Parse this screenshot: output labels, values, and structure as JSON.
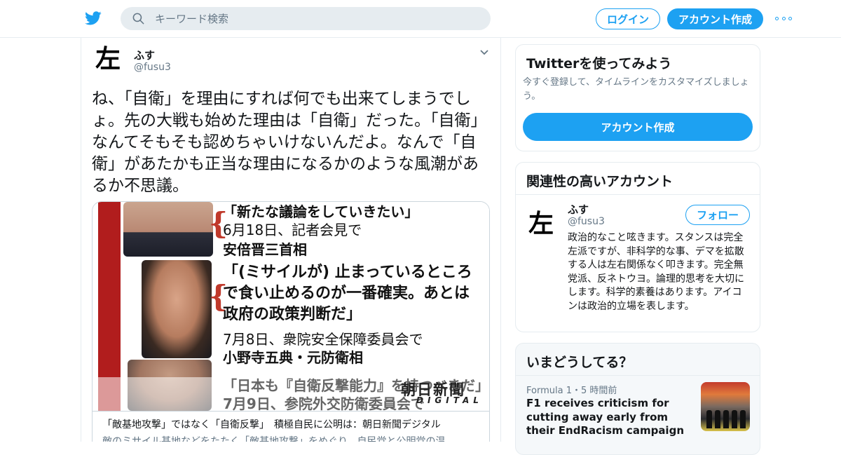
{
  "header": {
    "search_placeholder": "キーワード検索",
    "login_label": "ログイン",
    "signup_label": "アカウント作成"
  },
  "tweet": {
    "avatar_char": "左",
    "author_name": "ふす",
    "author_handle": "@fusu3",
    "text": "ね、「自衛」を理由にすれば何でも出来てしまうでしょ。先の大戦も始めた理由は「自衛」だった。「自衛」なんてそもそも認めちゃいけないんだよ。なんで「自衛」があたかも正当な理由になるかのような風潮があるか不思議。",
    "card": {
      "image_text": {
        "line1": "「新たな議論をしていきたい」",
        "line2": "6月18日、記者会見で",
        "line3": "安倍晋三首相",
        "quote2": "「(ミサイルが) 止まっているところで食い止めるのが一番確実。あとは政府の政策判断だ」",
        "line5": "7月8日、衆院安全保障委員会で",
        "line6": "小野寺五典・元防衛相",
        "line7": "「日本も『自衛反撃能力』を持つべきだ」",
        "line8": "7月9日、参院外交防衛委員会で",
        "logo": "朝日新聞",
        "logo_sub": "DIGITAL"
      },
      "title": "「敵基地攻撃」ではなく「自衛反撃」　積極自民に公明は：朝日新聞デジタル",
      "description": "敵のミサイル基地などをたたく「敵基地攻撃」をめぐり、自民党と公明党の温"
    }
  },
  "sidebar": {
    "try_twitter": {
      "title": "Twitterを使ってみよう",
      "desc": "今すぐ登録して、タイムラインをカスタマイズしましょう。",
      "cta": "アカウント作成"
    },
    "related": {
      "title": "関連性の高いアカウント",
      "avatar_char": "左",
      "name": "ふす",
      "handle": "@fusu3",
      "follow_label": "フォロー",
      "bio": "政治的なこと呟きます。スタンスは完全左派ですが、非科学的な事、デマを拡散する人は左右関係なく叩きます。完全無党派、反ネトウヨ。論理的思考を大切にします。科学的素養はあります。アイコンは政治的立場を表します。"
    },
    "trends": {
      "title": "いまどうしてる？",
      "meta": "Formula 1・5 時間前",
      "headline": "F1 receives criticism for cutting away early from their EndRacism campaign"
    }
  },
  "colors": {
    "accent": "#1da1f2",
    "border": "#e6ecf0",
    "muted": "#657786"
  }
}
